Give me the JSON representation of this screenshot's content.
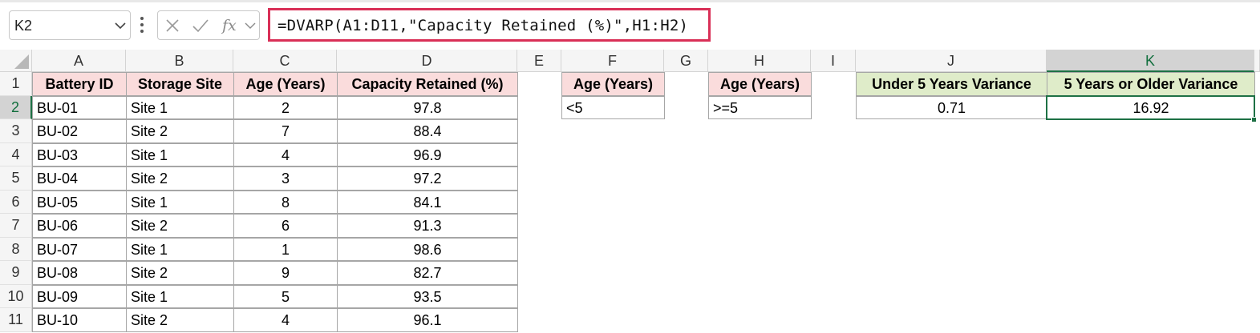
{
  "formula_bar": {
    "name_box": "K2",
    "formula": "=DVARP(A1:D11,\"Capacity Retained (%)\",H1:H2)"
  },
  "columns": [
    "A",
    "B",
    "C",
    "D",
    "E",
    "F",
    "G",
    "H",
    "I",
    "J",
    "K"
  ],
  "rows": [
    "1",
    "2",
    "3",
    "4",
    "5",
    "6",
    "7",
    "8",
    "9",
    "10",
    "11"
  ],
  "selected": {
    "column": "K",
    "row": "2"
  },
  "table": {
    "headers": [
      "Battery ID",
      "Storage Site",
      "Age (Years)",
      "Capacity Retained (%)"
    ],
    "rows": [
      [
        "BU-01",
        "Site 1",
        "2",
        "97.8"
      ],
      [
        "BU-02",
        "Site 2",
        "7",
        "88.4"
      ],
      [
        "BU-03",
        "Site 1",
        "4",
        "96.9"
      ],
      [
        "BU-04",
        "Site 2",
        "3",
        "97.2"
      ],
      [
        "BU-05",
        "Site 1",
        "8",
        "84.1"
      ],
      [
        "BU-06",
        "Site 2",
        "6",
        "91.3"
      ],
      [
        "BU-07",
        "Site 1",
        "1",
        "98.6"
      ],
      [
        "BU-08",
        "Site 2",
        "9",
        "82.7"
      ],
      [
        "BU-09",
        "Site 1",
        "5",
        "93.5"
      ],
      [
        "BU-10",
        "Site 2",
        "4",
        "96.1"
      ]
    ]
  },
  "criteria_f": {
    "header": "Age (Years)",
    "value": "<5"
  },
  "criteria_h": {
    "header": "Age (Years)",
    "value": ">=5"
  },
  "results": {
    "under_header": "Under 5 Years Variance",
    "under_value": "0.71",
    "older_header": "5 Years or Older Variance",
    "older_value": "16.92"
  },
  "colors": {
    "formula_highlight": "#d92f57",
    "header_fill_pink": "#fadcdc",
    "header_fill_green": "#dfecc9",
    "selection_green": "#1e7145"
  },
  "icons": [
    "chevron-down-icon",
    "more-vertical-icon",
    "cancel-x-icon",
    "confirm-check-icon",
    "fx-icon"
  ]
}
